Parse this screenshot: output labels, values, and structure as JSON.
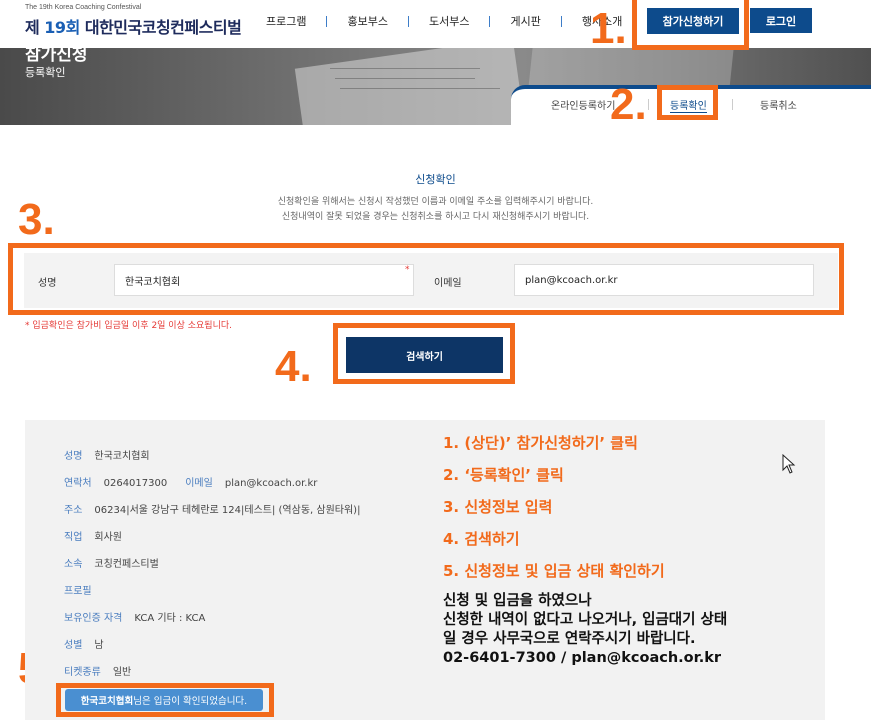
{
  "header": {
    "logo_sub": "The 19th Korea Coaching Confestival",
    "logo_prefix": "제 ",
    "logo_num": "19회",
    "logo_name": " 대한민국코칭컨페스티벌",
    "nav": [
      "프로그램",
      "홍보부스",
      "도서부스",
      "게시판",
      "행사소개"
    ],
    "apply_label": "참가신청하기",
    "login_label": "로그인"
  },
  "banner": {
    "title": "참가신청",
    "sub": "등록확인",
    "tabs": [
      "온라인등록하기",
      "등록확인",
      "등록취소"
    ],
    "active_tab": "등록확인"
  },
  "form": {
    "title": "신청확인",
    "desc1": "신청확인을 위해서는 신청시 작성했던 이름과 이메일 주소를 입력해주시기 바랍니다.",
    "desc2": "신청내역이 잘못 되었을 경우는 신청취소를 하시고 다시 재신청해주시기 바랍니다.",
    "name_label": "성명",
    "name_value": "한국코치협회",
    "email_label": "이메일",
    "email_value": "plan@kcoach.or.kr",
    "required_mark": "*",
    "note": "* 입금확인은 참가비 입금일 이후 2일 이상 소요됩니다.",
    "search_label": "검색하기"
  },
  "result": {
    "name_k": "성명",
    "name_v": "한국코치협회",
    "phone_k": "연락처",
    "phone_v": "0264017300",
    "email_k": "이메일",
    "email_v": "plan@kcoach.or.kr",
    "addr_k": "주소",
    "addr_v": "06234|서울 강남구 테헤란로 124|테스트| (역삼동, 삼원타워)|",
    "job_k": "직업",
    "job_v": "회사원",
    "org_k": "소속",
    "org_v": "코칭컨페스티벌",
    "profile_k": "프로필",
    "profile_v": "",
    "cert_k": "보유인증 자격",
    "cert_v": "KCA 기타 : KCA",
    "gender_k": "성별",
    "gender_v": "남",
    "ticket_k": "티켓종류",
    "ticket_v": "일반",
    "status_name": "한국코치협회",
    "status_text": "님은 입금이 확인되었습니다."
  },
  "annotations": {
    "nums": [
      "1.",
      "2.",
      "3.",
      "4.",
      "5."
    ],
    "steps": [
      "1. (상단)’ 참가신청하기’ 클릭",
      "2. ‘등록확인’ 클릭",
      "3. 신청정보 입력",
      "4. 검색하기",
      "5. 신청정보 및 입금 상태 확인하기"
    ],
    "notice": [
      "신청 및 입금을 하였으나",
      "신청한 내역이 없다고 나오거나, 입금대기 상태",
      "일 경우 사무국으로 연락주시기 바랍니다.",
      "02-6401-7300 / plan@kcoach.or.kr"
    ]
  },
  "colors": {
    "brand": "#0d4b8c",
    "annotation": "#f26a1b",
    "alert": "#e53935"
  }
}
